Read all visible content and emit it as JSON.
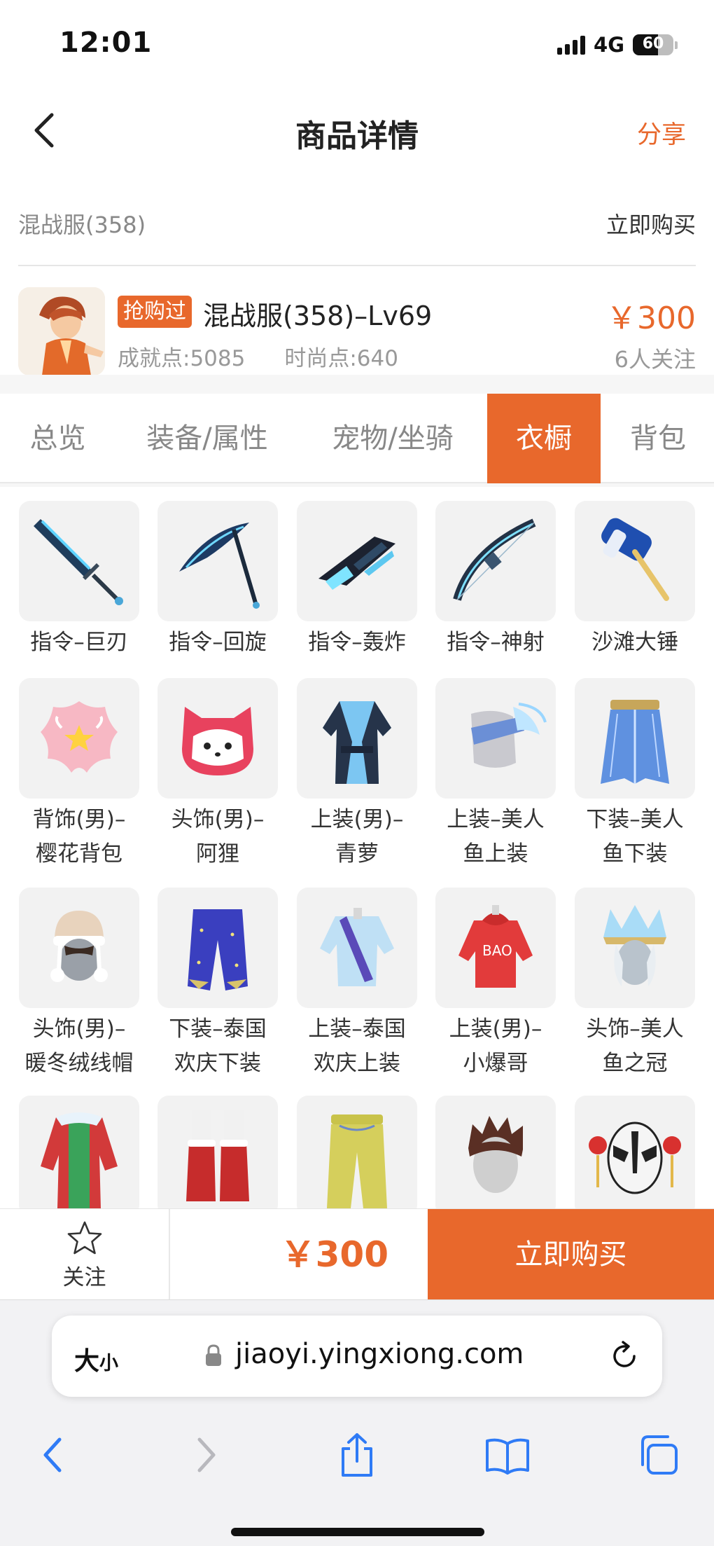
{
  "status_bar": {
    "time": "12:01",
    "network": "4G",
    "battery": "60"
  },
  "header": {
    "title": "商品详情",
    "share_label": "分享"
  },
  "subheader": {
    "server": "混战服(358)",
    "buy_link": "立即购买"
  },
  "product": {
    "tag": "抢购过",
    "name": "混战服(358)–Lv69",
    "achievement": "成就点:5085",
    "fashion": "时尚点:640",
    "price": "￥300",
    "followers": "6人关注"
  },
  "tabs": [
    {
      "label": "总览",
      "active": false
    },
    {
      "label": "装备/属性",
      "active": false
    },
    {
      "label": "宠物/坐骑",
      "active": false
    },
    {
      "label": "衣橱",
      "active": true
    },
    {
      "label": "背包",
      "active": false
    }
  ],
  "items": [
    {
      "line1": "指令–巨刃",
      "line2": "",
      "icon": "greatsword-icon"
    },
    {
      "line1": "指令–回旋",
      "line2": "",
      "icon": "scythe-icon"
    },
    {
      "line1": "指令–轰炸",
      "line2": "",
      "icon": "blaster-icon"
    },
    {
      "line1": "指令–神射",
      "line2": "",
      "icon": "bow-icon"
    },
    {
      "line1": "沙滩大锤",
      "line2": "",
      "icon": "hammer-icon"
    },
    {
      "line1": "背饰(男)–",
      "line2": "樱花背包",
      "icon": "sakura-backpack-icon"
    },
    {
      "line1": "头饰(男)–",
      "line2": "阿狸",
      "icon": "ali-fox-head-icon"
    },
    {
      "line1": "上装(男)–",
      "line2": "青萝",
      "icon": "blue-robe-icon"
    },
    {
      "line1": "上装–美人",
      "line2": "鱼上装",
      "icon": "mermaid-top-icon"
    },
    {
      "line1": "下装–美人",
      "line2": "鱼下装",
      "icon": "mermaid-skirt-icon"
    },
    {
      "line1": "头饰(男)–",
      "line2": "暖冬绒线帽",
      "icon": "knit-hat-icon"
    },
    {
      "line1": "下装–泰国",
      "line2": "欢庆下装",
      "icon": "thai-pants-icon"
    },
    {
      "line1": "上装–泰国",
      "line2": "欢庆上装",
      "icon": "thai-top-icon"
    },
    {
      "line1": "上装(男)–",
      "line2": "小爆哥",
      "icon": "red-hoodie-icon"
    },
    {
      "line1": "头饰–美人",
      "line2": "鱼之冠",
      "icon": "mermaid-crown-icon"
    },
    {
      "line1": "",
      "line2": "",
      "icon": "christmas-coat-icon"
    },
    {
      "line1": "",
      "line2": "",
      "icon": "red-boots-icon"
    },
    {
      "line1": "",
      "line2": "",
      "icon": "yellow-pants-icon"
    },
    {
      "line1": "",
      "line2": "",
      "icon": "spiky-hair-icon"
    },
    {
      "line1": "",
      "line2": "",
      "icon": "opera-mask-icon"
    }
  ],
  "action_bar": {
    "follow_label": "关注",
    "price": "￥300",
    "buy_label": "立即购买"
  },
  "browser": {
    "text_size_big": "大",
    "text_size_small": "小",
    "url": "jiaoyi.yingxiong.com"
  },
  "colors": {
    "accent": "#e8682c"
  }
}
